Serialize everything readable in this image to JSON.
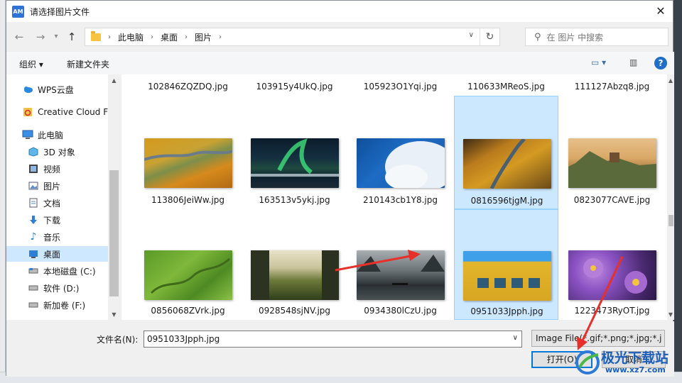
{
  "dialog": {
    "app_badge": "AM",
    "title": "请选择图片文件",
    "close_glyph": "✕"
  },
  "nav": {
    "breadcrumbs": [
      "此电脑",
      "桌面",
      "图片"
    ],
    "search_placeholder": "在 图片 中搜索"
  },
  "toolbar": {
    "organize": "组织 ▾",
    "new_folder": "新建文件夹"
  },
  "sidebar": {
    "items": [
      {
        "label": "WPS云盘",
        "icon": "cloud-icon"
      },
      {
        "label": "Creative Cloud Fi",
        "icon": "creative-cloud-icon"
      },
      {
        "label": "此电脑",
        "icon": "computer-icon"
      },
      {
        "label": "3D 对象",
        "icon": "cube-icon"
      },
      {
        "label": "视频",
        "icon": "video-icon"
      },
      {
        "label": "图片",
        "icon": "picture-icon"
      },
      {
        "label": "文档",
        "icon": "document-icon"
      },
      {
        "label": "下载",
        "icon": "download-icon"
      },
      {
        "label": "音乐",
        "icon": "music-icon"
      },
      {
        "label": "桌面",
        "icon": "desktop-icon",
        "selected": true
      },
      {
        "label": "本地磁盘 (C:)",
        "icon": "drive-icon"
      },
      {
        "label": "软件 (D:)",
        "icon": "drive-icon"
      },
      {
        "label": "新加卷 (F:)",
        "icon": "drive-icon"
      }
    ]
  },
  "files": {
    "row0": [
      "102846ZQZDQ.jpg",
      "103915y4UkQ.jpg",
      "105923O1Yqi.jpg",
      "110633MReoS.jpg",
      "111127Abzq8.jpg"
    ],
    "row1": [
      "113806JeiWw.jpg",
      "163513v5ykj.jpg",
      "210143cb1Y8.jpg",
      "0816596tjgM.jpg",
      "0823077CAVE.jpg"
    ],
    "row2": [
      "0856068ZVrk.jpg",
      "0928548sjNV.jpg",
      "0934380lCzU.jpg",
      "0951033Jpph.jpg",
      "1223473RyOT.jpg"
    ],
    "selected": "0951033Jpph.jpg"
  },
  "footer": {
    "filename_label": "文件名(N):",
    "filename_value": "0951033Jpph.jpg",
    "filetype": "Image File(*.gif;*.png;*.jpg;*.j",
    "open_button": "打开(O)",
    "cancel_button": "取消"
  },
  "watermark": {
    "title": "极光下载站",
    "url": "www.xz7.com"
  },
  "colors": {
    "selection": "#cce8ff",
    "accent": "#0078d7",
    "arrow": "#e8302a"
  }
}
